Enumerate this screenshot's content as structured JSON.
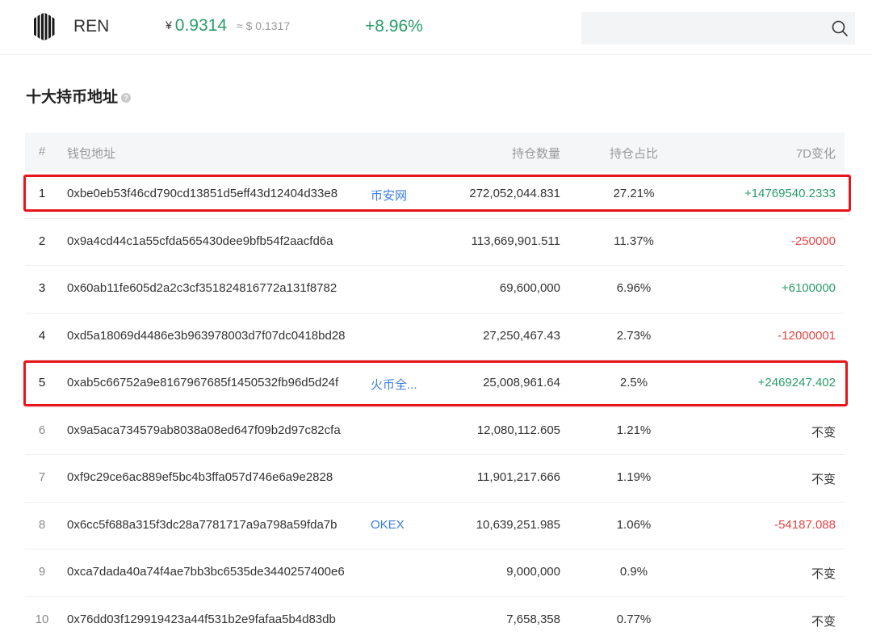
{
  "header": {
    "coin_name": "REN",
    "price_symbol": "¥",
    "price": "0.9314",
    "usd_price": "≈ $ 0.1317",
    "change": "+8.96%",
    "search_placeholder": ""
  },
  "section": {
    "title": "十大持币地址",
    "help": "?"
  },
  "table": {
    "columns": [
      "#",
      "钱包地址",
      "持仓数量",
      "持仓占比",
      "7D变化"
    ],
    "rows": [
      {
        "rank": "1",
        "address": "0xbe0eb53f46cd790cd13851d5eff43d12404d33e8",
        "tag": "币安网",
        "quantity": "272,052,044.831",
        "percent": "27.21%",
        "change": "+14769540.2333",
        "trend": "pos"
      },
      {
        "rank": "2",
        "address": "0x9a4cd44c1a55cfda565430dee9bfb54f2aacfd6a",
        "tag": "",
        "quantity": "113,669,901.511",
        "percent": "11.37%",
        "change": "-250000",
        "trend": "neg"
      },
      {
        "rank": "3",
        "address": "0x60ab11fe605d2a2c3cf351824816772a131f8782",
        "tag": "",
        "quantity": "69,600,000",
        "percent": "6.96%",
        "change": "+6100000",
        "trend": "pos"
      },
      {
        "rank": "4",
        "address": "0xd5a18069d4486e3b963978003d7f07dc0418bd28",
        "tag": "",
        "quantity": "27,250,467.43",
        "percent": "2.73%",
        "change": "-12000001",
        "trend": "neg"
      },
      {
        "rank": "5",
        "address": "0xab5c66752a9e8167967685f1450532fb96d5d24f",
        "tag": "火币全...",
        "quantity": "25,008,961.64",
        "percent": "2.5%",
        "change": "+2469247.402",
        "trend": "pos"
      },
      {
        "rank": "6",
        "address": "0x9a5aca734579ab8038a08ed647f09b2d97c82cfa",
        "tag": "",
        "quantity": "12,080,112.605",
        "percent": "1.21%",
        "change": "不变",
        "trend": "flat"
      },
      {
        "rank": "7",
        "address": "0xf9c29ce6ac889ef5bc4b3ffa057d746e6a9e2828",
        "tag": "",
        "quantity": "11,901,217.666",
        "percent": "1.19%",
        "change": "不变",
        "trend": "flat"
      },
      {
        "rank": "8",
        "address": "0x6cc5f688a315f3dc28a7781717a9a798a59fda7b",
        "tag": "OKEX",
        "quantity": "10,639,251.985",
        "percent": "1.06%",
        "change": "-54187.088",
        "trend": "neg"
      },
      {
        "rank": "9",
        "address": "0xca7dada40a74f4ae7bb3bc6535de3440257400e6",
        "tag": "",
        "quantity": "9,000,000",
        "percent": "0.9%",
        "change": "不变",
        "trend": "flat"
      },
      {
        "rank": "10",
        "address": "0x76dd03f129919423a44f531b2e9fafaa5b4d83db",
        "tag": "",
        "quantity": "7,658,358",
        "percent": "0.77%",
        "change": "不变",
        "trend": "flat"
      }
    ]
  },
  "colors": {
    "positive": "#2a9d6a",
    "negative": "#e64545",
    "link": "#3a7de0",
    "highlight": "#e8141c"
  },
  "icons": {
    "logo": "ren-logo",
    "search": "search-icon",
    "help": "help-icon"
  }
}
